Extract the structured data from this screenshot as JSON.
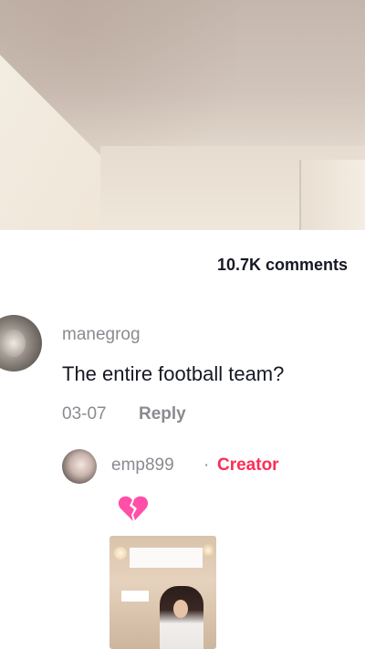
{
  "comments_panel": {
    "count_label": "10.7K comments"
  },
  "comment": {
    "username": "manegrog",
    "text": "The entire football team?",
    "date": "03-07",
    "reply_label": "Reply"
  },
  "reply": {
    "username": "emp899",
    "separator": "·",
    "creator_label": "Creator",
    "emoji_icon": "broken-heart-icon",
    "thumbnail_icon": "video-thumbnail"
  },
  "colors": {
    "creator_accent": "#fe2c55",
    "text_primary": "#161823",
    "text_secondary": "#8a8b91"
  }
}
